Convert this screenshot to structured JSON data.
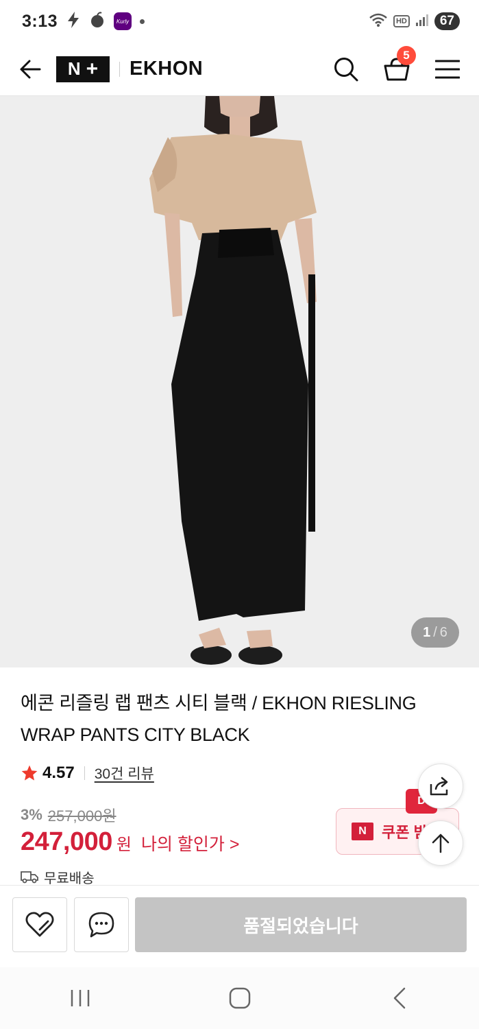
{
  "status_bar": {
    "time": "3:13",
    "kurly_label": "Kurly",
    "battery": "67",
    "hd_label": "HD"
  },
  "header": {
    "logo_n": "N",
    "logo_plus": "+",
    "brand": "EKHON",
    "cart_count": "5"
  },
  "gallery": {
    "current": "1",
    "separator": "/",
    "total": "6"
  },
  "product": {
    "title": "에콘 리즐링 랩 팬츠 시티 블랙 / EKHON RIESLING WRAP PANTS CITY BLACK",
    "rating": "4.57",
    "review_link": "30건 리뷰",
    "discount_rate": "3%",
    "original_price": "257,000원",
    "sale_price": "247,000",
    "sale_unit": "원",
    "my_discount": "나의 할인가 >",
    "shipping": "무료배송"
  },
  "coupon": {
    "badge": "N",
    "label": "쿠폰 받",
    "tag": "D"
  },
  "bottom_bar": {
    "soldout_label": "품절되었습니다"
  },
  "colors": {
    "accent_red": "#d3203a",
    "cart_badge": "#ff4c3b",
    "soldout_bg": "#c4c4c4"
  }
}
